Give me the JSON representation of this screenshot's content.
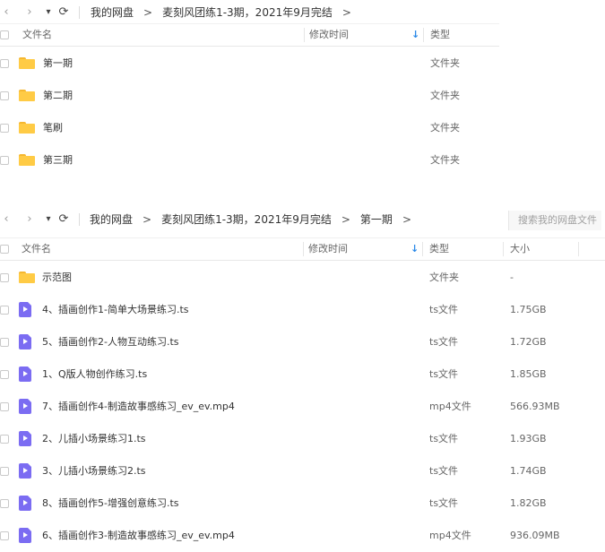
{
  "top_pane": {
    "nav": {
      "back": "‹",
      "forward": "›",
      "dropdown": "▾",
      "refresh": "⟳"
    },
    "breadcrumb": [
      "我的网盘",
      "麦刻风团练1-3期，2021年9月完结"
    ],
    "breadcrumb_sep": ">",
    "headers": {
      "name": "文件名",
      "modified": "修改时间",
      "type": "类型",
      "sort_arrow": "↓"
    },
    "rows": [
      {
        "name": "第一期",
        "type": "文件夹",
        "icon": "folder-icon"
      },
      {
        "name": "第二期",
        "type": "文件夹",
        "icon": "folder-icon"
      },
      {
        "name": "笔刷",
        "type": "文件夹",
        "icon": "folder-icon"
      },
      {
        "name": "第三期",
        "type": "文件夹",
        "icon": "folder-icon"
      }
    ]
  },
  "bottom_pane": {
    "nav": {
      "back": "‹",
      "forward": "›",
      "dropdown": "▾",
      "refresh": "⟳"
    },
    "breadcrumb": [
      "我的网盘",
      "麦刻风团练1-3期，2021年9月完结",
      "第一期"
    ],
    "breadcrumb_sep": ">",
    "search_placeholder": "搜索我的网盘文件",
    "headers": {
      "name": "文件名",
      "modified": "修改时间",
      "type": "类型",
      "size": "大小",
      "sort_arrow": "↓"
    },
    "rows": [
      {
        "name": "示范图",
        "type": "文件夹",
        "size": "-",
        "icon": "folder-icon"
      },
      {
        "name": "4、插画创作1-简单大场景练习.ts",
        "type": "ts文件",
        "size": "1.75GB",
        "icon": "video-file-icon"
      },
      {
        "name": "5、插画创作2-人物互动练习.ts",
        "type": "ts文件",
        "size": "1.72GB",
        "icon": "video-file-icon"
      },
      {
        "name": "1、Q版人物创作练习.ts",
        "type": "ts文件",
        "size": "1.85GB",
        "icon": "video-file-icon"
      },
      {
        "name": "7、插画创作4-制造故事感练习_ev_ev.mp4",
        "type": "mp4文件",
        "size": "566.93MB",
        "icon": "video-file-icon"
      },
      {
        "name": "2、儿插小场景练习1.ts",
        "type": "ts文件",
        "size": "1.93GB",
        "icon": "video-file-icon"
      },
      {
        "name": "3、儿插小场景练习2.ts",
        "type": "ts文件",
        "size": "1.74GB",
        "icon": "video-file-icon"
      },
      {
        "name": "8、插画创作5-增强创意练习.ts",
        "type": "ts文件",
        "size": "1.82GB",
        "icon": "video-file-icon"
      },
      {
        "name": "6、插画创作3-制造故事感练习_ev_ev.mp4",
        "type": "mp4文件",
        "size": "936.09MB",
        "icon": "video-file-icon"
      }
    ]
  },
  "colors": {
    "folder": "#ffcb45",
    "video_file": "#7b6cf2",
    "sort_accent": "#2b8ae8"
  }
}
